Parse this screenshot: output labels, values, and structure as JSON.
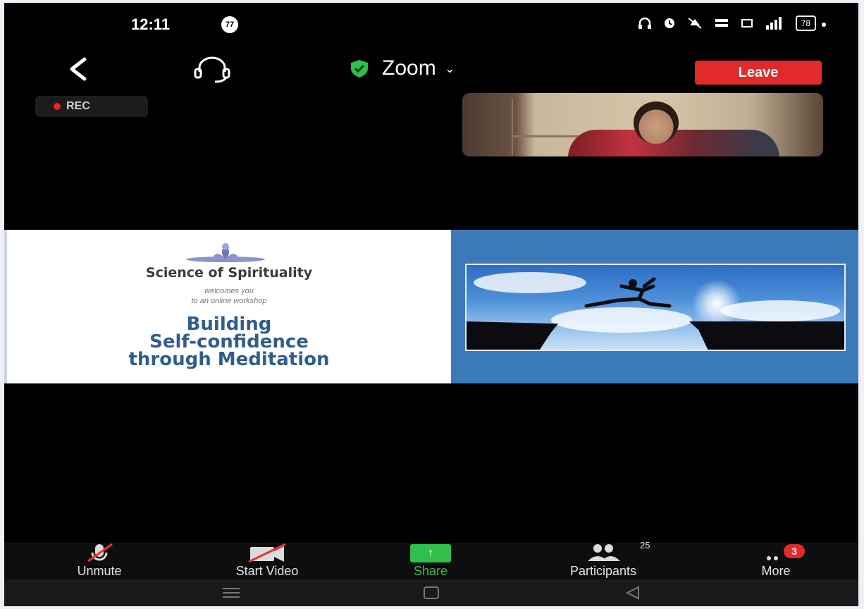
{
  "status_bar": {
    "time": "12:11",
    "notification_count": "77",
    "battery": "78"
  },
  "header": {
    "meeting_title": "Zoom",
    "leave_label": "Leave"
  },
  "recording": {
    "label": "REC"
  },
  "shared_slide": {
    "org_name": "Science of Spirituality",
    "welcome_line1": "welcomes you",
    "welcome_line2": "to an online workshop",
    "title_line1": "Building",
    "title_line2": "Self-confidence",
    "title_line3": "through Meditation"
  },
  "toolbar": {
    "unmute_label": "Unmute",
    "start_video_label": "Start Video",
    "share_label": "Share",
    "participants_label": "Participants",
    "participants_count": "25",
    "more_label": "More",
    "more_badge": "3"
  },
  "icons": {
    "back": "back-arrow-icon",
    "audio": "headset-icon",
    "shield": "shield-check-icon",
    "mic": "mic-muted-icon",
    "video": "video-off-icon",
    "share": "share-arrow-icon",
    "participants": "people-icon",
    "more": "more-dots-icon"
  },
  "colors": {
    "leave": "#e12b2b",
    "share": "#2fbf4a",
    "shield": "#2fbf4a",
    "slide_title": "#2e5e8e"
  }
}
